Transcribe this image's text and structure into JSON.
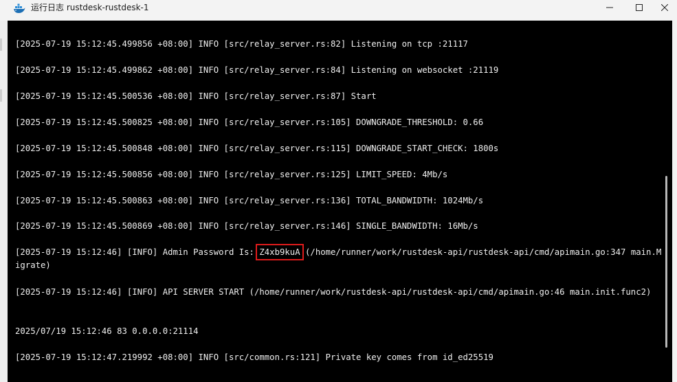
{
  "window": {
    "title": "运行日志 rustdesk-rustdesk-1",
    "minimize_icon": "minimize-icon",
    "maximize_icon": "maximize-icon",
    "close_icon": "close-icon",
    "app_icon": "docker-whale-icon"
  },
  "console": {
    "background": "#000000",
    "text_color": "#f0f0f0",
    "highlight_color": "#e01b1b",
    "lines": [
      "[2025-07-19 15:12:45.499856 +08:00] INFO [src/relay_server.rs:82] Listening on tcp :21117",
      "[2025-07-19 15:12:45.499862 +08:00] INFO [src/relay_server.rs:84] Listening on websocket :21119",
      "[2025-07-19 15:12:45.500536 +08:00] INFO [src/relay_server.rs:87] Start",
      "[2025-07-19 15:12:45.500825 +08:00] INFO [src/relay_server.rs:105] DOWNGRADE_THRESHOLD: 0.66",
      "[2025-07-19 15:12:45.500848 +08:00] INFO [src/relay_server.rs:115] DOWNGRADE_START_CHECK: 1800s",
      "[2025-07-19 15:12:45.500856 +08:00] INFO [src/relay_server.rs:125] LIMIT_SPEED: 4Mb/s",
      "[2025-07-19 15:12:45.500863 +08:00] INFO [src/relay_server.rs:136] TOTAL_BANDWIDTH: 1024Mb/s",
      "[2025-07-19 15:12:45.500869 +08:00] INFO [src/relay_server.rs:146] SINGLE_BANDWIDTH: 16Mb/s"
    ],
    "admin_line": {
      "prefix": "[2025-07-19 15:12:46] [INFO] Admin Password Is: ",
      "password": "Z4xb9kuA",
      "suffix": " (/home/runner/work/rustdesk-api/rustdesk-api/cmd/apimain.go:347 main.Migrate)"
    },
    "api_line": "[2025-07-19 15:12:46] [INFO] API SERVER START (/home/runner/work/rustdesk-api/rustdesk-api/cmd/apimain.go:46 main.init.func2)",
    "plain_line": "2025/07/19 15:12:46 83 0.0.0.0:21114",
    "last_line": "[2025-07-19 15:12:47.219992 +08:00] INFO [src/common.rs:121] Private key comes from id_ed25519"
  }
}
